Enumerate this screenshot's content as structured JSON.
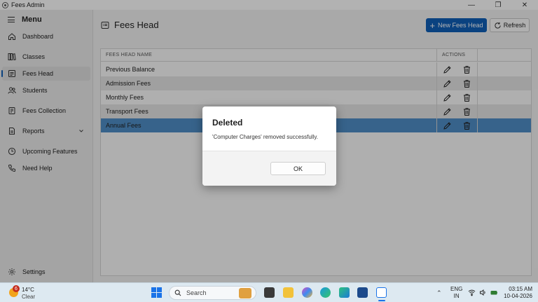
{
  "window": {
    "title": "Fees Admin"
  },
  "sidebar": {
    "menu_label": "Menu",
    "items": [
      {
        "label": "Dashboard",
        "icon": "home-icon"
      },
      {
        "label": "Classes",
        "icon": "books-icon"
      },
      {
        "label": "Fees Head",
        "icon": "document-list-icon",
        "active": true
      },
      {
        "label": "Students",
        "icon": "people-icon"
      },
      {
        "label": "Fees Collection",
        "icon": "receipt-icon"
      },
      {
        "label": "Reports",
        "icon": "report-icon",
        "expandable": true
      },
      {
        "label": "Upcoming Features",
        "icon": "clock-icon"
      },
      {
        "label": "Need Help",
        "icon": "phone-icon"
      }
    ],
    "settings_label": "Settings"
  },
  "main": {
    "page_title": "Fees Head",
    "new_button_label": "New Fees Head",
    "refresh_label": "Refresh",
    "table": {
      "columns": [
        "FEES HEAD NAME",
        "ACTIONS"
      ],
      "rows": [
        {
          "name": "Previous Balance"
        },
        {
          "name": "Admission Fees"
        },
        {
          "name": "Monthly Fees"
        },
        {
          "name": "Transport Fees"
        },
        {
          "name": "Annual Fees",
          "selected": true
        }
      ]
    }
  },
  "dialog": {
    "title": "Deleted",
    "message": "'Computer Charges' removed successfully.",
    "ok_label": "OK"
  },
  "taskbar": {
    "weather": {
      "badge": "6",
      "temperature": "14°C",
      "condition": "Clear"
    },
    "search_placeholder": "Search",
    "language": [
      "ENG",
      "IN"
    ],
    "time": "03:15 AM",
    "date": "10-04-2026"
  },
  "colors": {
    "accent": "#0f5fb8",
    "selected_row": "#4f8ec8",
    "sidebar_bg": "#ebebeb",
    "taskbar_bg": "#dde9f1"
  }
}
